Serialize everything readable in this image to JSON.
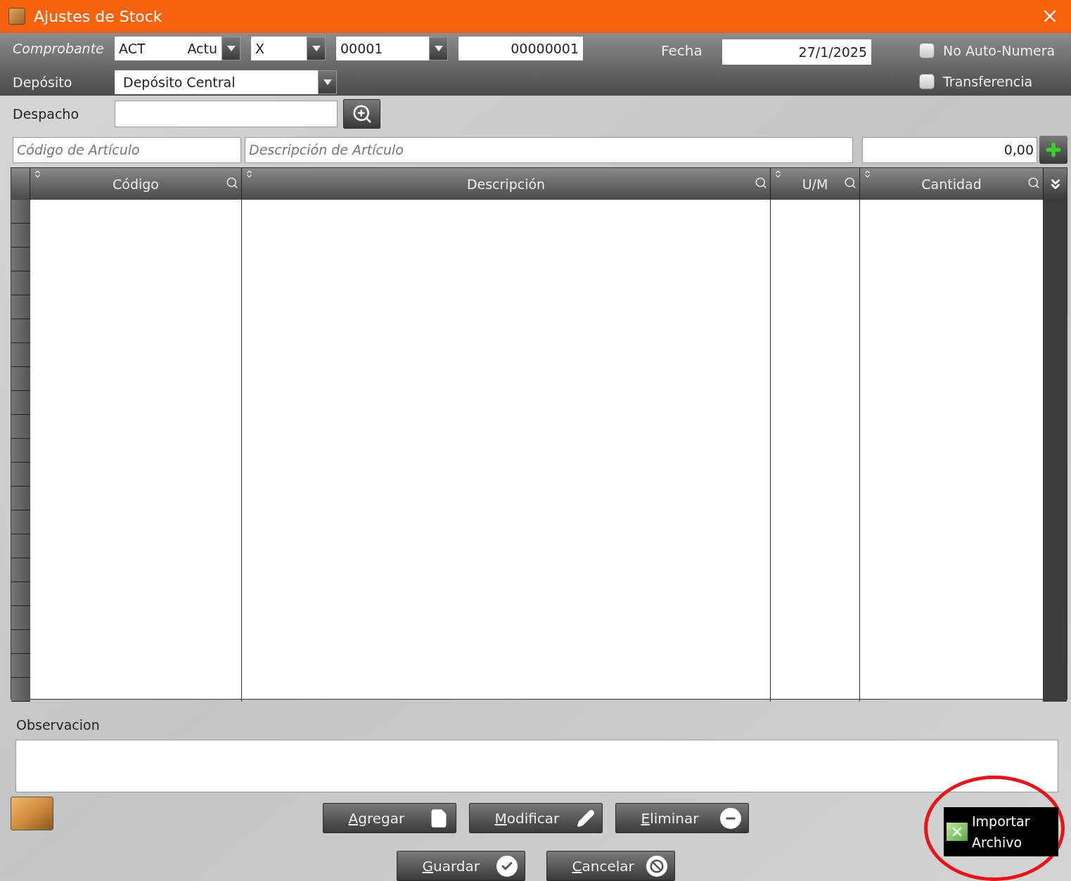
{
  "window": {
    "title": "Ajustes de Stock"
  },
  "header": {
    "comprobante": {
      "label": "Comprobante",
      "type_code": "ACT",
      "type_name": "Actu",
      "letter": "X",
      "point_of_sale": "00001",
      "number": "00000001"
    },
    "fecha": {
      "label": "Fecha",
      "value": "27/1/2025"
    },
    "deposito": {
      "label": "Depósito",
      "value": "Depósito Central"
    },
    "options": [
      {
        "label": "No Auto-Numera",
        "checked": false
      },
      {
        "label": "Transferencia",
        "checked": false
      }
    ]
  },
  "despacho": {
    "label": "Despacho"
  },
  "item_entry": {
    "code_placeholder": "Código de Artículo",
    "description_placeholder": "Descripción de Artículo",
    "quantity": "0,00"
  },
  "table": {
    "columns": [
      "Código",
      "Descripción",
      "U/M",
      "Cantidad"
    ]
  },
  "observacion": {
    "label": "Observacion"
  },
  "buttons": [
    {
      "label": "Agregar",
      "kind": "add"
    },
    {
      "label": "Modificar",
      "kind": "edit"
    },
    {
      "label": "Eliminar",
      "kind": "delete"
    },
    {
      "label": "Guardar",
      "kind": "save"
    },
    {
      "label": "Cancelar",
      "kind": "cancel"
    }
  ],
  "import_button": {
    "lines": [
      "Importar",
      "Archivo"
    ]
  }
}
